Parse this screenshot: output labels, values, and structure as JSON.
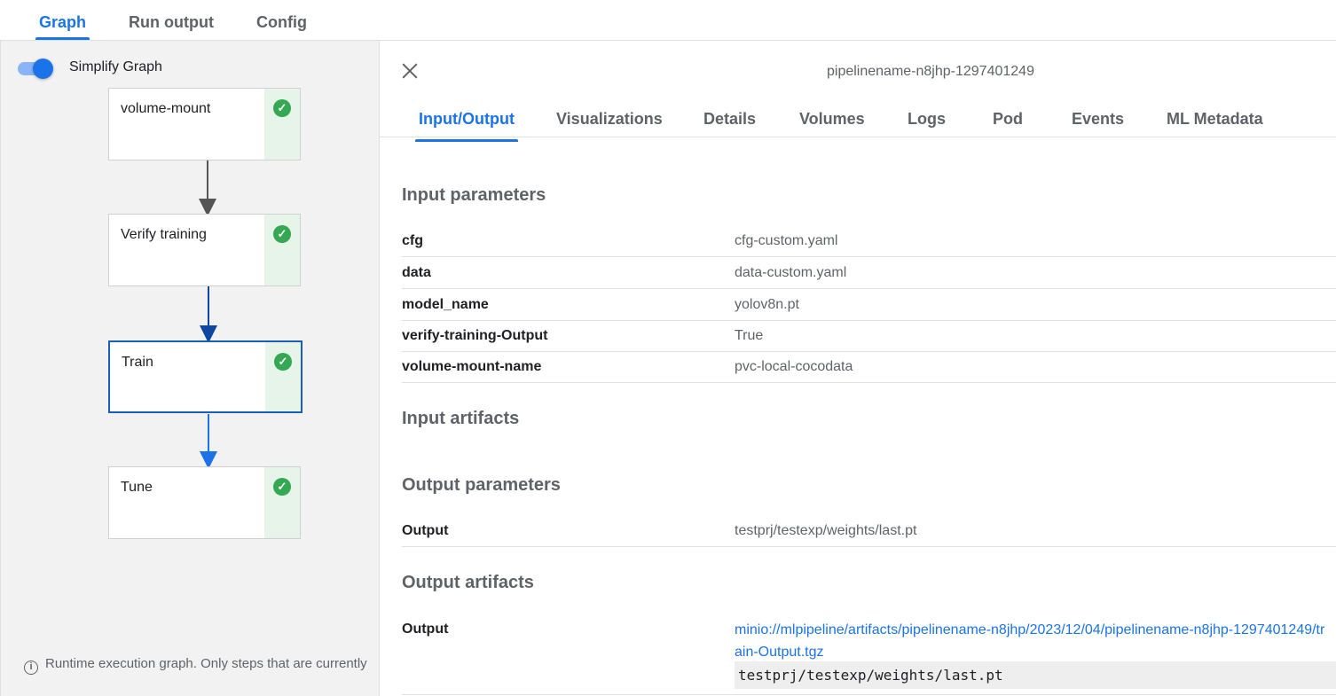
{
  "top_tabs": [
    "Graph",
    "Run output",
    "Config"
  ],
  "graph": {
    "simplify_label": "Simplify Graph",
    "simplify_on": true,
    "nodes": [
      {
        "label": "volume-mount",
        "status": "succeeded"
      },
      {
        "label": "Verify training",
        "status": "succeeded"
      },
      {
        "label": "Train",
        "status": "succeeded",
        "selected": true
      },
      {
        "label": "Tune",
        "status": "succeeded"
      }
    ],
    "footer_note": "Runtime execution graph. Only steps that are currently"
  },
  "details": {
    "run_name": "pipelinename-n8jhp-1297401249",
    "tabs": [
      "Input/Output",
      "Visualizations",
      "Details",
      "Volumes",
      "Logs",
      "Pod",
      "Events",
      "ML Metadata"
    ],
    "active_tab": "Input/Output",
    "input_parameters_title": "Input parameters",
    "input_parameters": [
      {
        "key": "cfg",
        "value": "cfg-custom.yaml"
      },
      {
        "key": "data",
        "value": "data-custom.yaml"
      },
      {
        "key": "model_name",
        "value": "yolov8n.pt"
      },
      {
        "key": "verify-training-Output",
        "value": "True"
      },
      {
        "key": "volume-mount-name",
        "value": "pvc-local-cocodata"
      }
    ],
    "input_artifacts_title": "Input artifacts",
    "output_parameters_title": "Output parameters",
    "output_parameters": [
      {
        "key": "Output",
        "value": "testprj/testexp/weights/last.pt"
      }
    ],
    "output_artifacts_title": "Output artifacts",
    "output_artifacts": [
      {
        "key": "Output",
        "uri": "minio://mlpipeline/artifacts/pipelinename-n8jhp/2023/12/04/pipelinename-n8jhp-1297401249/train-Output.tgz",
        "preview": "testprj/testexp/weights/last.pt"
      }
    ]
  },
  "colors": {
    "accent": "#1a73e8",
    "success": "#34a853",
    "success_bg": "#e6f4ea",
    "panel_bg": "#f2f2f2"
  },
  "icons": {
    "close": "close-icon",
    "check": "check-circle-icon",
    "info": "info-icon"
  }
}
